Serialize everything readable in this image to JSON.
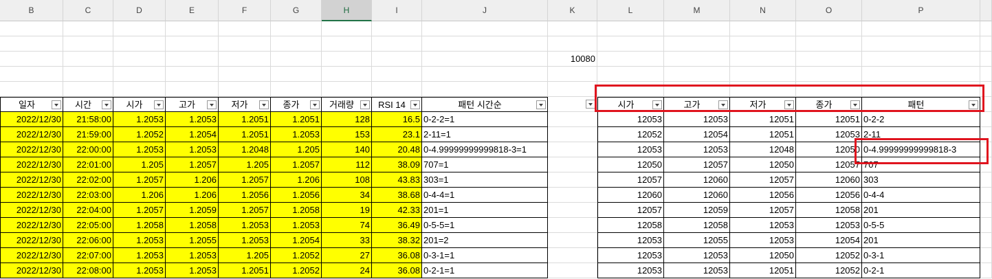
{
  "columns": [
    "B",
    "C",
    "D",
    "E",
    "F",
    "G",
    "H",
    "I",
    "J",
    "K",
    "L",
    "M",
    "N",
    "O",
    "P"
  ],
  "selected_column": "H",
  "k3_value": "10080",
  "left_headers": [
    "일자",
    "시간",
    "시가",
    "고가",
    "저가",
    "종가",
    "거래량",
    "RSI 14",
    "패턴 시간순"
  ],
  "right_headers": [
    "시가",
    "고가",
    "저가",
    "종가",
    "패턴"
  ],
  "left_rows": [
    [
      "2022/12/30",
      "21:58:00",
      "1.2053",
      "1.2053",
      "1.2051",
      "1.2051",
      "128",
      "16.5",
      "0-2-2=1"
    ],
    [
      "2022/12/30",
      "21:59:00",
      "1.2052",
      "1.2054",
      "1.2051",
      "1.2053",
      "153",
      "23.1",
      "2-11=1"
    ],
    [
      "2022/12/30",
      "22:00:00",
      "1.2053",
      "1.2053",
      "1.2048",
      "1.205",
      "140",
      "20.48",
      "0-4.99999999999818-3=1"
    ],
    [
      "2022/12/30",
      "22:01:00",
      "1.205",
      "1.2057",
      "1.205",
      "1.2057",
      "112",
      "38.09",
      "707=1"
    ],
    [
      "2022/12/30",
      "22:02:00",
      "1.2057",
      "1.206",
      "1.2057",
      "1.206",
      "108",
      "43.83",
      "303=1"
    ],
    [
      "2022/12/30",
      "22:03:00",
      "1.206",
      "1.206",
      "1.2056",
      "1.2056",
      "34",
      "38.68",
      "0-4-4=1"
    ],
    [
      "2022/12/30",
      "22:04:00",
      "1.2057",
      "1.2059",
      "1.2057",
      "1.2058",
      "19",
      "42.33",
      "201=1"
    ],
    [
      "2022/12/30",
      "22:05:00",
      "1.2058",
      "1.2058",
      "1.2053",
      "1.2053",
      "74",
      "36.49",
      "0-5-5=1"
    ],
    [
      "2022/12/30",
      "22:06:00",
      "1.2053",
      "1.2055",
      "1.2053",
      "1.2054",
      "33",
      "38.32",
      "201=2"
    ],
    [
      "2022/12/30",
      "22:07:00",
      "1.2053",
      "1.2053",
      "1.205",
      "1.2052",
      "27",
      "36.08",
      "0-3-1=1"
    ],
    [
      "2022/12/30",
      "22:08:00",
      "1.2053",
      "1.2053",
      "1.2051",
      "1.2052",
      "24",
      "36.08",
      "0-2-1=1"
    ]
  ],
  "right_rows": [
    [
      "12053",
      "12053",
      "12051",
      "12051",
      "0-2-2"
    ],
    [
      "12052",
      "12054",
      "12051",
      "12053",
      "2-11"
    ],
    [
      "12053",
      "12053",
      "12048",
      "12050",
      "0-4.99999999999818-3"
    ],
    [
      "12050",
      "12057",
      "12050",
      "12057",
      "707"
    ],
    [
      "12057",
      "12060",
      "12057",
      "12060",
      "303"
    ],
    [
      "12060",
      "12060",
      "12056",
      "12056",
      "0-4-4"
    ],
    [
      "12057",
      "12059",
      "12057",
      "12058",
      "201"
    ],
    [
      "12058",
      "12058",
      "12053",
      "12053",
      "0-5-5"
    ],
    [
      "12053",
      "12055",
      "12053",
      "12054",
      "201"
    ],
    [
      "12053",
      "12053",
      "12050",
      "12052",
      "0-3-1"
    ],
    [
      "12053",
      "12053",
      "12051",
      "12052",
      "0-2-1"
    ]
  ],
  "colors": {
    "highlight": "#ffff00",
    "annotation": "#e0141e",
    "selected_header": "#217346"
  }
}
